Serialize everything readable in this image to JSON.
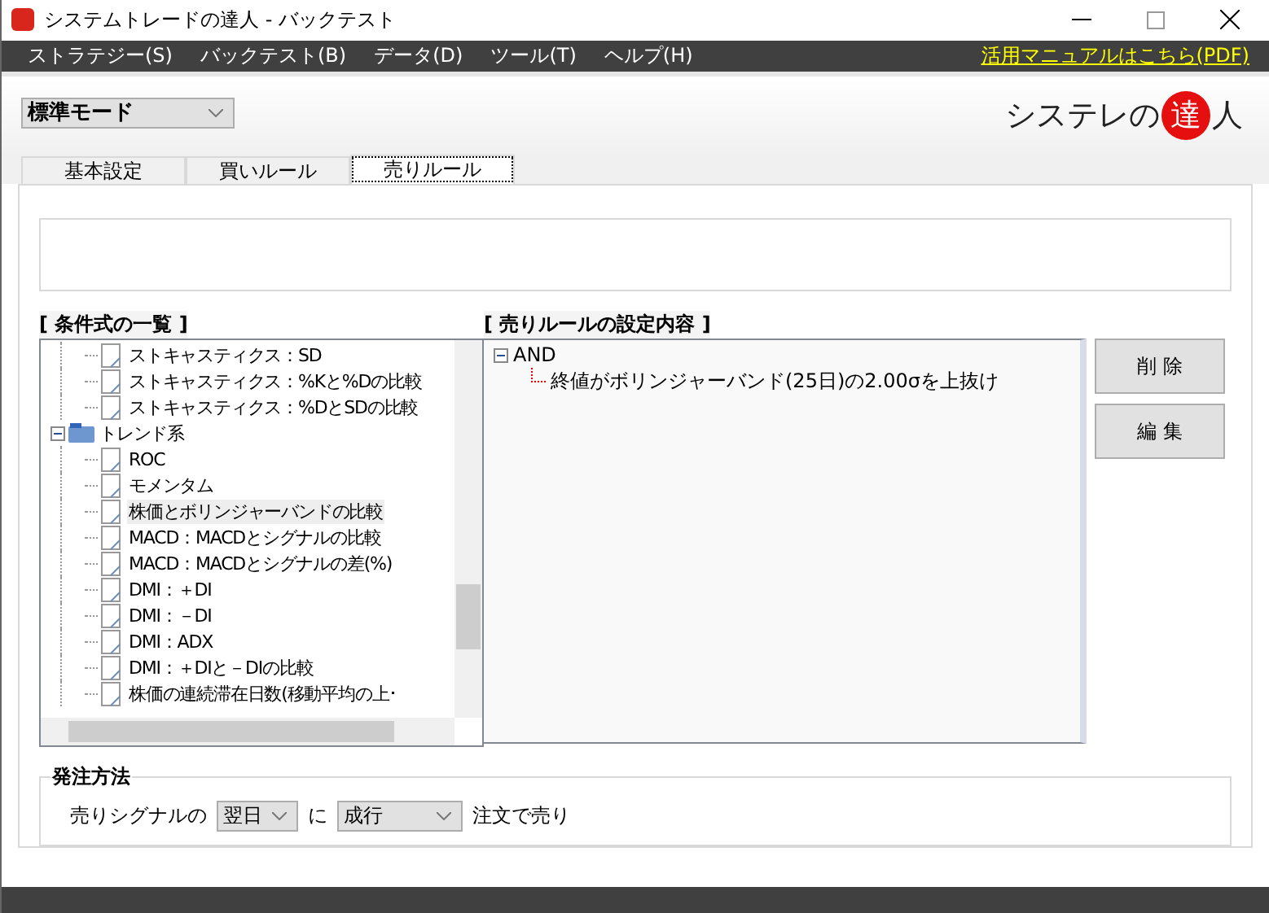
{
  "window": {
    "title": "システムトレードの達人 - バックテスト"
  },
  "menu": [
    {
      "label": "ストラテジー(S)"
    },
    {
      "label": "バックテスト(B)"
    },
    {
      "label": "データ(D)"
    },
    {
      "label": "ツール(T)"
    },
    {
      "label": "ヘルプ(H)"
    }
  ],
  "manual_link": "活用マニュアルはこちら(PDF)",
  "mode_select": {
    "value": "標準モード"
  },
  "logo": {
    "text_before": "システレの",
    "seal": "達",
    "text_after": "人"
  },
  "tabs": [
    {
      "label": "基本設定",
      "selected": false
    },
    {
      "label": "買いルール",
      "selected": false
    },
    {
      "label": "売りルール",
      "selected": true
    }
  ],
  "conditions": {
    "heading": "[ 条件式の一覧 ]",
    "nodes": [
      {
        "kind": "continued",
        "children": [
          {
            "label": "ストキャスティクス：SD",
            "selected": false
          },
          {
            "label": "ストキャスティクス：%Kと%Dの比較",
            "selected": false
          },
          {
            "label": "ストキャスティクス：%DとSDの比較",
            "selected": false
          }
        ]
      },
      {
        "kind": "folder",
        "label": "トレンド系",
        "expanded": true,
        "children": [
          {
            "label": "ROC",
            "selected": false
          },
          {
            "label": "モメンタム",
            "selected": false
          },
          {
            "label": "株価とボリンジャーバンドの比較",
            "selected": true
          },
          {
            "label": "MACD：MACDとシグナルの比較",
            "selected": false
          },
          {
            "label": "MACD：MACDとシグナルの差(%)",
            "selected": false
          },
          {
            "label": "DMI：＋DI",
            "selected": false
          },
          {
            "label": "DMI：－DI",
            "selected": false
          },
          {
            "label": "DMI：ADX",
            "selected": false
          },
          {
            "label": "DMI：＋DIと－DIの比較",
            "selected": false
          },
          {
            "label": "株価の連続滞在日数(移動平均の上･",
            "selected": false
          }
        ]
      }
    ]
  },
  "rules": {
    "heading": "[ 売りルールの設定内容 ]",
    "nodes": [
      {
        "label": "AND",
        "expanded": true,
        "children": [
          {
            "label": "終値がボリンジャーバンド(25日)の2.00σを上抜け"
          }
        ]
      }
    ]
  },
  "buttons": [
    {
      "label": "削 除"
    },
    {
      "label": "編 集"
    }
  ],
  "order": {
    "title": "発注方法",
    "prefix": "売りシグナルの",
    "timing": "翌日",
    "middle": "に",
    "type": "成行",
    "suffix": "注文で売り"
  }
}
